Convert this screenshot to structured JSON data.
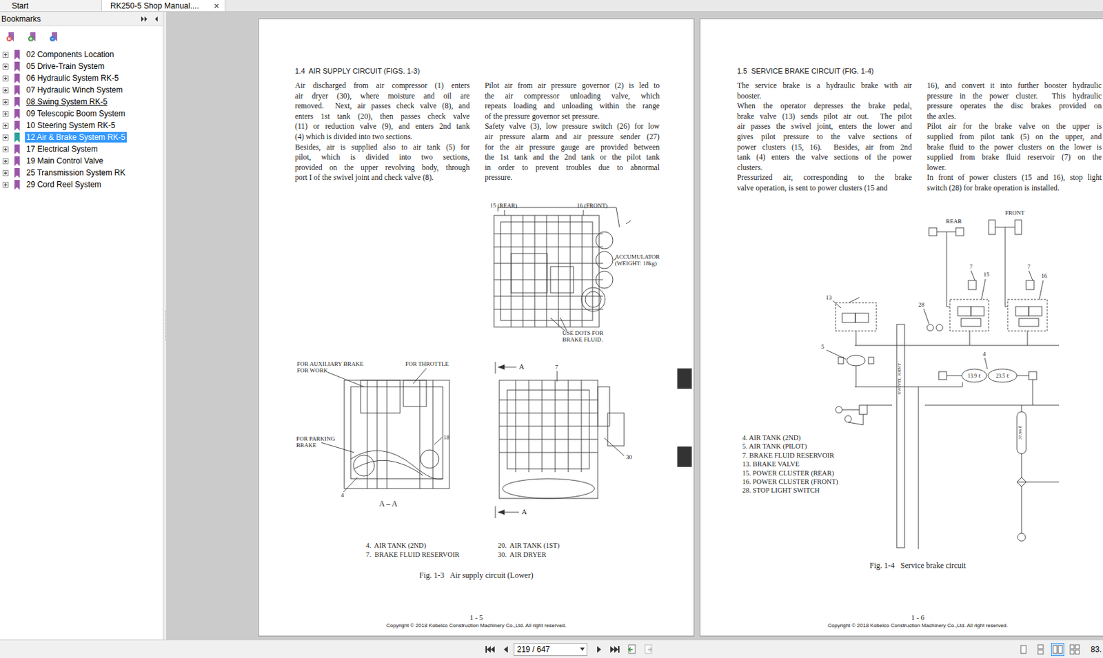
{
  "tabs": [
    {
      "label": "Start",
      "selected": false
    },
    {
      "label": "RK250-5 Shop Manual....",
      "selected": true,
      "close": "✕"
    }
  ],
  "sidebar": {
    "title": "Bookmarks",
    "items": [
      {
        "label": "02 Components Location",
        "expanded": false,
        "selected": false,
        "hovered": false
      },
      {
        "label": "05 Drive-Train System",
        "expanded": false,
        "selected": false,
        "hovered": false
      },
      {
        "label": "06 Hydraulic System RK-5",
        "expanded": false,
        "selected": false,
        "hovered": false
      },
      {
        "label": "07 Hydraulic Winch System",
        "expanded": false,
        "selected": false,
        "hovered": false
      },
      {
        "label": "08 Swing System RK-5",
        "expanded": false,
        "selected": false,
        "hovered": true
      },
      {
        "label": "09 Telescopic Boom System",
        "expanded": false,
        "selected": false,
        "hovered": false
      },
      {
        "label": "10 Steering System RK-5",
        "expanded": false,
        "selected": false,
        "hovered": false
      },
      {
        "label": "12 Air & Brake System RK-5",
        "expanded": false,
        "selected": true,
        "hovered": false
      },
      {
        "label": "17 Electrical System",
        "expanded": false,
        "selected": false,
        "hovered": false
      },
      {
        "label": "19 Main Control Valve",
        "expanded": false,
        "selected": false,
        "hovered": false
      },
      {
        "label": "25 Transmission System RK",
        "expanded": false,
        "selected": false,
        "hovered": false
      },
      {
        "label": "29 Cord Reel System",
        "expanded": false,
        "selected": false,
        "hovered": false
      }
    ]
  },
  "left_page": {
    "heading": "1.4  AIR SUPPLY CIRCUIT (FIGS. 1-3)",
    "columns": [
      [
        {
          "lines": [
            "Air discharged from air compressor (1) enters",
            "air dryer (30), where moisture and oil are",
            "removed.  Next, air passes check valve (8), and",
            "enters 1st tank (20), then passes check valve",
            "(11) or reduction valve (9), and enters 2nd tank",
            "(4) which is divided into two sections."
          ]
        },
        {
          "lines": [
            "Besides, air is supplied also to air tank (5) for",
            "pilot, which is divided into two sections,",
            "provided on the upper revolving body, through",
            "port I of the swivel joint and check valve (8)."
          ]
        }
      ],
      [
        {
          "lines": [
            "Pilot air from air pressure governor (2) is led to",
            "the air compressor unloading valve, which",
            "repeats loading and unloading within the range",
            "of the pressure governor set pressure."
          ]
        },
        {
          "lines": [
            "Safety valve (3), low pressure switch (26) for low",
            "air pressure alarm and air pressure sender (27)",
            "for the air pressure gauge are provided between",
            "the 1st tank and the 2nd tank or the pilot tank",
            "in order to prevent troubles due to abnormal",
            "pressure."
          ]
        }
      ]
    ],
    "figures": [
      [
        [
          "15 (REAR)"
        ],
        [
          "16 (FRONT)"
        ],
        [
          "ACCUMULATOR",
          "(WEIGHT: 18kg)"
        ],
        [
          "USE DOTS FOR",
          "BRAKE FLUID."
        ]
      ],
      [
        [
          "FOR AUXILIARY BRAKE",
          "FOR WORK"
        ],
        [
          "FOR THROTTLE"
        ],
        [
          "FOR PARKING",
          "BRAKE"
        ],
        [
          "18"
        ],
        [
          "4"
        ],
        [
          "A – A"
        ]
      ],
      [
        [
          "A"
        ],
        [
          "7"
        ],
        [
          "30"
        ],
        [
          "A"
        ]
      ]
    ],
    "legend": [
      [
        "4.  AIR TANK (2ND)",
        "7.  BRAKE FLUID RESERVOIR"
      ],
      [
        "20.  AIR TANK (1ST)",
        "30.  AIR DRYER"
      ]
    ],
    "caption": "Fig. 1-3   Air supply circuit (Lower)",
    "page_number": "1 - 5",
    "copyright": "Copyright © 2018 Kobelco Construction Machinery Co.,Ltd. All right reserved."
  },
  "right_page": {
    "heading": "1.5  SERVICE BRAKE CIRCUIT (FIG. 1-4)",
    "columns": [
      [
        {
          "lines": [
            "The service brake is a hydraulic brake with air",
            "booster."
          ]
        },
        {
          "lines": [
            "When the operator depresses the brake pedal,",
            "brake valve (13) sends pilot air out.  The pilot",
            "air passes the swivel joint, enters the lower and",
            "gives pilot pressure to the valve sections of",
            "power clusters (15, 16).  Besides, air from 2nd",
            "tank (4) enters the valve sections of the power",
            "clusters."
          ]
        },
        {
          "lines": [
            "Pressurized air, corresponding to the brake",
            "valve operation, is sent to power clusters (15 and"
          ]
        }
      ],
      [
        {
          "lines": [
            "16), and convert it into further booster hydraulic",
            "pressure in the power cluster.  This hydraulic",
            "pressure operates the disc brakes provided on",
            "the axles."
          ]
        },
        {
          "lines": [
            "Pilot air for the brake valve on the upper is",
            "supplied from pilot tank (5) on the upper, and",
            "brake fluid to the power clusters on the lower is",
            "supplied from brake fluid reservoir (7) on the",
            "lower."
          ]
        },
        {
          "lines": [
            "In front of power clusters (15 and 16), stop light",
            "switch (28) for brake operation is installed."
          ]
        }
      ]
    ],
    "diagram": {
      "front": "FRONT",
      "rear": "REAR",
      "reservoir_rear": "7",
      "cluster_rear": "15",
      "reservoir_front": "7",
      "cluster_front": "16",
      "brake_valve": "13",
      "stop_switch": "28",
      "tank_2nd": "4",
      "tank_pilot": "5",
      "volume_a": "13.9 ℓ",
      "volume_b": "23.5 ℓ",
      "volume_c": "37.96 ℓ",
      "swivel": "SWIVEL JOINT"
    },
    "legend": [
      "4. AIR TANK (2ND)",
      "5. AIR TANK (PILOT)",
      "7. BRAKE FLUID RESERVOIR",
      "13. BRAKE VALVE",
      "15. POWER CLUSTER (REAR)",
      "16. POWER CLUSTER (FRONT)",
      "28. STOP LIGHT SWITCH"
    ],
    "caption": "Fig. 1-4   Service brake circuit",
    "page_number": "1 - 6",
    "copyright": "Copyright © 2018 Kobelco Construction Machinery Co.,Ltd. All right reserved."
  },
  "toolbar": {
    "page_field": "219 / 647",
    "zoom": "83.",
    "view_modes": [
      {
        "kind": "single",
        "selected": false
      },
      {
        "kind": "continuous",
        "selected": false
      },
      {
        "kind": "facing",
        "selected": true
      },
      {
        "kind": "facing-continuous",
        "selected": false
      }
    ]
  }
}
